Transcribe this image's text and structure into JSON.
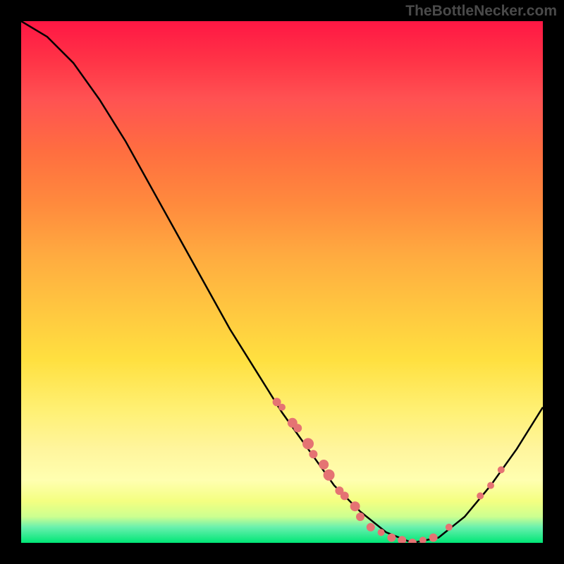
{
  "watermark": "TheBottleNecker.com",
  "chart_data": {
    "type": "line",
    "title": "",
    "xlabel": "",
    "ylabel": "",
    "xlim": [
      0,
      100
    ],
    "ylim": [
      0,
      100
    ],
    "curve": {
      "name": "bottleneck-curve",
      "points": [
        {
          "x": 0,
          "y": 100
        },
        {
          "x": 5,
          "y": 97
        },
        {
          "x": 10,
          "y": 92
        },
        {
          "x": 15,
          "y": 85
        },
        {
          "x": 20,
          "y": 77
        },
        {
          "x": 25,
          "y": 68
        },
        {
          "x": 30,
          "y": 59
        },
        {
          "x": 35,
          "y": 50
        },
        {
          "x": 40,
          "y": 41
        },
        {
          "x": 45,
          "y": 33
        },
        {
          "x": 50,
          "y": 25
        },
        {
          "x": 55,
          "y": 18
        },
        {
          "x": 60,
          "y": 11
        },
        {
          "x": 65,
          "y": 6
        },
        {
          "x": 70,
          "y": 2
        },
        {
          "x": 75,
          "y": 0
        },
        {
          "x": 80,
          "y": 1
        },
        {
          "x": 85,
          "y": 5
        },
        {
          "x": 90,
          "y": 11
        },
        {
          "x": 95,
          "y": 18
        },
        {
          "x": 100,
          "y": 26
        }
      ]
    },
    "markers": {
      "name": "data-points",
      "color": "#e57373",
      "points": [
        {
          "x": 49,
          "y": 27,
          "r": 6
        },
        {
          "x": 50,
          "y": 26,
          "r": 5
        },
        {
          "x": 52,
          "y": 23,
          "r": 7
        },
        {
          "x": 53,
          "y": 22,
          "r": 6
        },
        {
          "x": 55,
          "y": 19,
          "r": 8
        },
        {
          "x": 56,
          "y": 17,
          "r": 6
        },
        {
          "x": 58,
          "y": 15,
          "r": 7
        },
        {
          "x": 59,
          "y": 13,
          "r": 8
        },
        {
          "x": 61,
          "y": 10,
          "r": 6
        },
        {
          "x": 62,
          "y": 9,
          "r": 6
        },
        {
          "x": 64,
          "y": 7,
          "r": 7
        },
        {
          "x": 65,
          "y": 5,
          "r": 6
        },
        {
          "x": 67,
          "y": 3,
          "r": 6
        },
        {
          "x": 69,
          "y": 2,
          "r": 5
        },
        {
          "x": 71,
          "y": 1,
          "r": 6
        },
        {
          "x": 73,
          "y": 0.5,
          "r": 6
        },
        {
          "x": 75,
          "y": 0,
          "r": 6
        },
        {
          "x": 77,
          "y": 0.5,
          "r": 5
        },
        {
          "x": 79,
          "y": 1,
          "r": 6
        },
        {
          "x": 82,
          "y": 3,
          "r": 5
        },
        {
          "x": 88,
          "y": 9,
          "r": 5
        },
        {
          "x": 90,
          "y": 11,
          "r": 5
        },
        {
          "x": 92,
          "y": 14,
          "r": 5
        }
      ]
    },
    "gradient_stops": [
      {
        "pos": 0,
        "color": "#ff1744"
      },
      {
        "pos": 50,
        "color": "#ffc640"
      },
      {
        "pos": 90,
        "color": "#fff59d"
      },
      {
        "pos": 100,
        "color": "#00e676"
      }
    ]
  }
}
